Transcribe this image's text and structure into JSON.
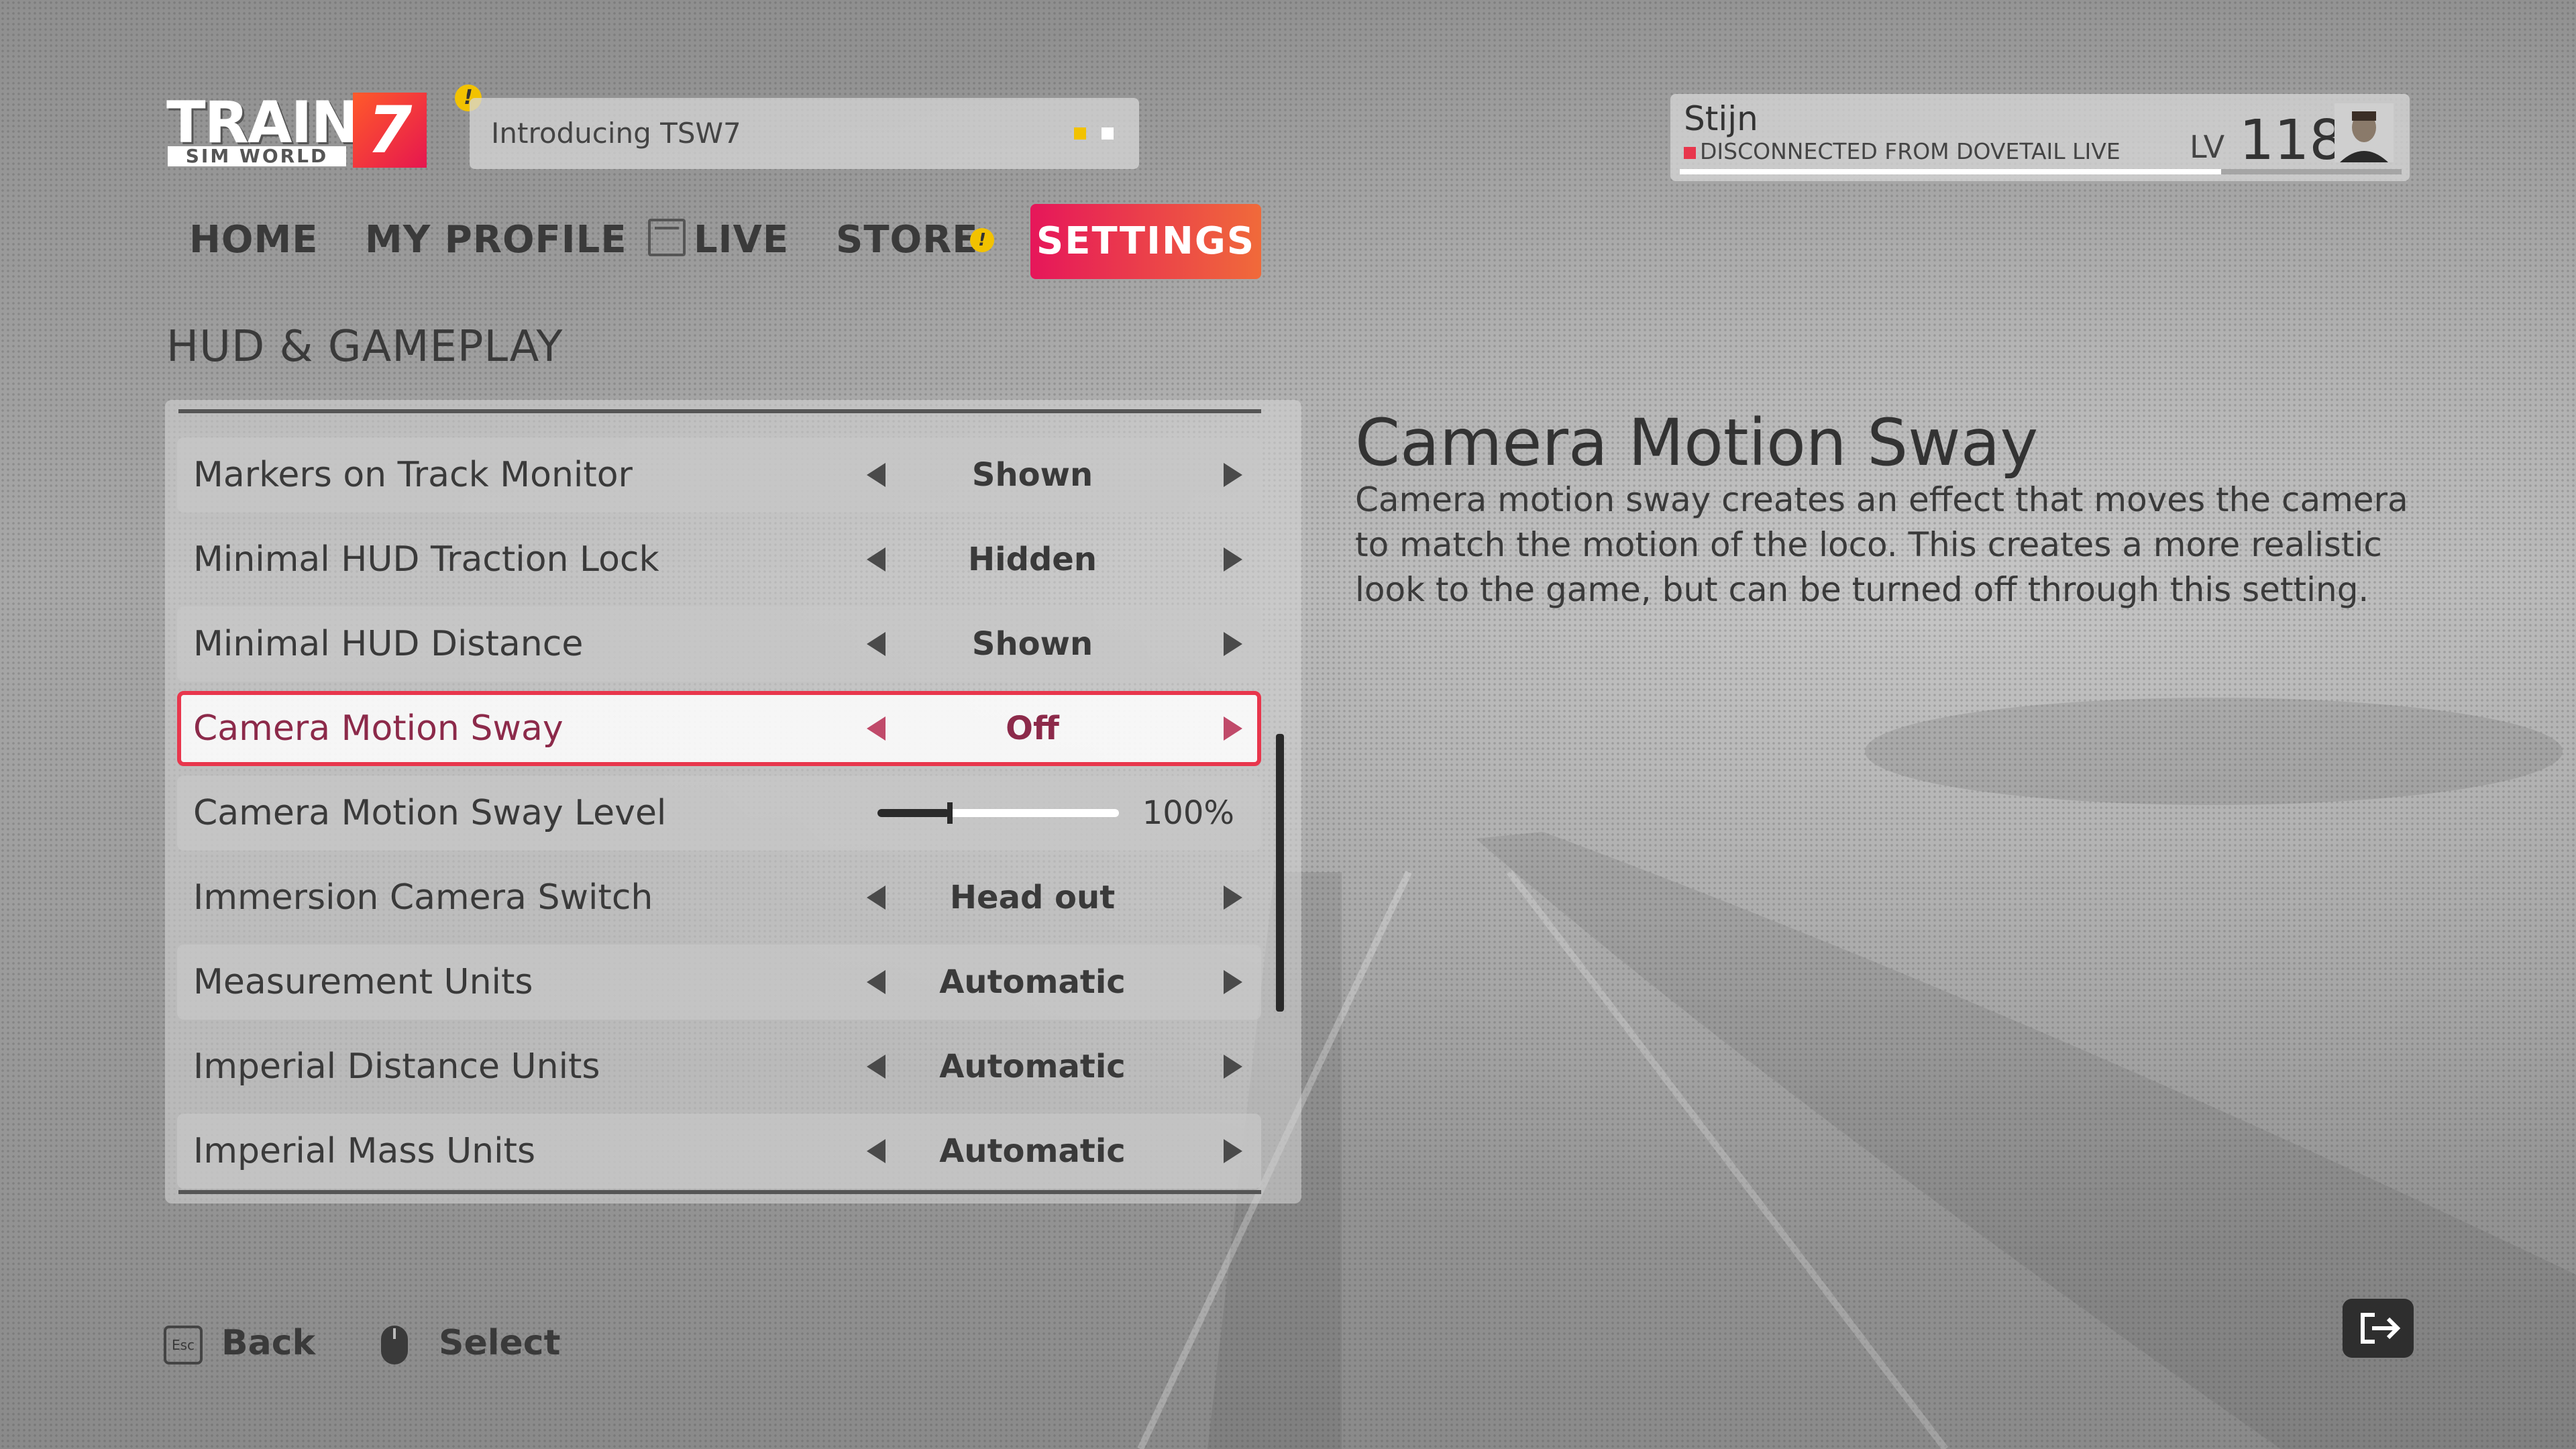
{
  "app": {
    "logo_word": "TRAIN",
    "logo_sub": "SIM WORLD",
    "logo_number": "7",
    "logo_alert": "!"
  },
  "news": {
    "text": "Introducing TSW7",
    "dot_colors": [
      "#f2c200",
      "#ffffff"
    ]
  },
  "profile": {
    "name": "Stijn",
    "status": "DISCONNECTED FROM DOVETAIL LIVE",
    "level_label": "LV",
    "level": "118",
    "xp_progress": 0.75,
    "status_color": "#e8364c"
  },
  "nav": {
    "home": "HOME",
    "my_profile": "MY PROFILE",
    "live": "LIVE",
    "store": "STORE",
    "store_alert": "!",
    "settings": "SETTINGS"
  },
  "section": {
    "title": "HUD & GAMEPLAY"
  },
  "settings": [
    {
      "label": "Markers on Track Monitor",
      "value": "Shown"
    },
    {
      "label": "Minimal HUD Traction Lock",
      "value": "Hidden"
    },
    {
      "label": "Minimal HUD Distance",
      "value": "Shown"
    },
    {
      "label": "Camera Motion Sway",
      "value": "Off",
      "selected": true
    },
    {
      "label": "Camera Motion Sway Level",
      "value": "100%",
      "slider_level": 0.3
    },
    {
      "label": "Immersion Camera Switch",
      "value": "Head out"
    },
    {
      "label": "Measurement Units",
      "value": "Automatic"
    },
    {
      "label": "Imperial Distance Units",
      "value": "Automatic"
    },
    {
      "label": "Imperial Mass Units",
      "value": "Automatic"
    }
  ],
  "description": {
    "title": "Camera Motion Sway",
    "body": "Camera motion sway creates an effect that moves the camera to match the motion of the loco. This creates a more realistic look to the game, but can be turned off through this setting."
  },
  "footer": {
    "back_key": "Esc",
    "back_label": "Back",
    "select_label": "Select",
    "exit_icon": "exit-icon"
  },
  "colors": {
    "accent": "#e8364c",
    "settings_gradient_start": "#e6165a",
    "settings_gradient_end": "#f06a3a"
  }
}
